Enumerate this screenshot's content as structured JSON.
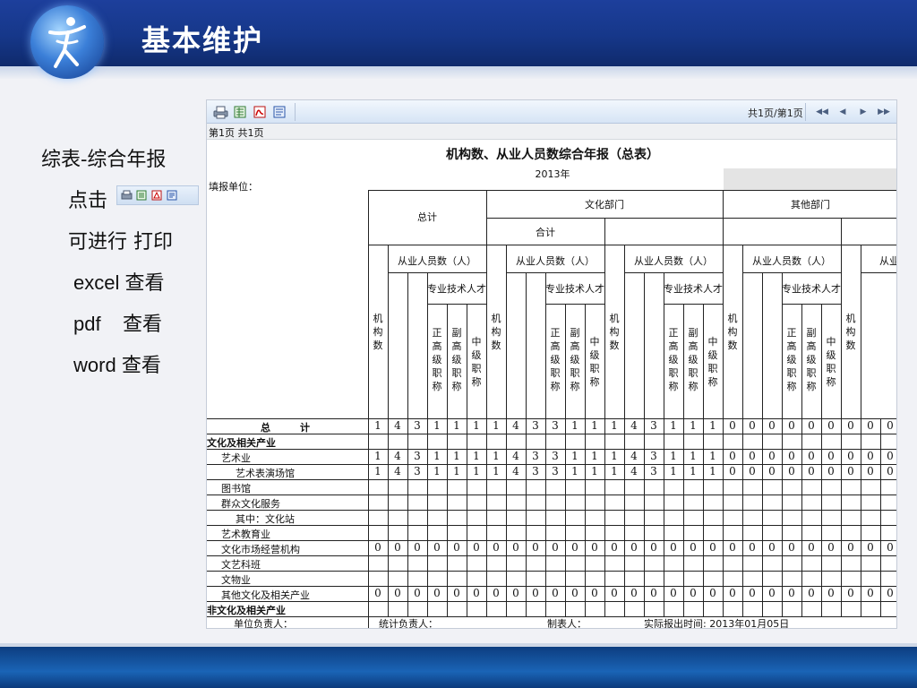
{
  "header": {
    "title": "基本维护"
  },
  "sidebar": {
    "line1": "综表-综合年报",
    "line2": "点击",
    "line3": "可进行 打印",
    "line4_a": "excel",
    "line4_b": "查看",
    "line5_a": "pdf",
    "line5_b": "查看",
    "line6_a": "word",
    "line6_b": "查看"
  },
  "viewer": {
    "toolbar": {
      "buttons": [
        "print-icon",
        "excel-icon",
        "pdf-icon",
        "word-icon"
      ],
      "page_counter": "共1页/第1页",
      "nav": [
        "first-page-icon",
        "prev-page-icon",
        "next-page-icon",
        "last-page-icon"
      ]
    },
    "page_info": "第1页  共1页",
    "report": {
      "title": "机构数、从业人员数综合年报（总表）",
      "year": "2013年",
      "fill_unit": "填报单位：",
      "headers": {
        "total": "总计",
        "culture_dept": "文化部门",
        "subtotal": "合计",
        "other_dept": "其他部门",
        "staff": "从业人员数（人）",
        "staff_cut": "从业",
        "tech": "专业技术人才",
        "orgs": "机构数",
        "senior": "正高级职称",
        "vice_senior": "副高级职称",
        "middle": "中级职称"
      },
      "rows": [
        {
          "label": "总　　　计",
          "values": [
            "1",
            "4",
            "3",
            "1",
            "1",
            "1",
            "1",
            "4",
            "3",
            "3",
            "1",
            "1",
            "1",
            "4",
            "3",
            "1",
            "1",
            "1",
            "0",
            "0",
            "0",
            "0",
            "0",
            "0",
            "0",
            "0",
            "0"
          ]
        },
        {
          "label": "文化及相关产业",
          "values": []
        },
        {
          "label": "艺术业",
          "values": [
            "1",
            "4",
            "3",
            "1",
            "1",
            "1",
            "1",
            "4",
            "3",
            "3",
            "1",
            "1",
            "1",
            "4",
            "3",
            "1",
            "1",
            "1",
            "0",
            "0",
            "0",
            "0",
            "0",
            "0",
            "0",
            "0",
            "0"
          ]
        },
        {
          "label": "艺术表演场馆",
          "values": [
            "1",
            "4",
            "3",
            "1",
            "1",
            "1",
            "1",
            "4",
            "3",
            "3",
            "1",
            "1",
            "1",
            "4",
            "3",
            "1",
            "1",
            "1",
            "0",
            "0",
            "0",
            "0",
            "0",
            "0",
            "0",
            "0",
            "0"
          ]
        },
        {
          "label": "图书馆",
          "values": []
        },
        {
          "label": "群众文化服务",
          "values": []
        },
        {
          "label": "其中：文化站",
          "values": []
        },
        {
          "label": "艺术教育业",
          "values": []
        },
        {
          "label": "文化市场经营机构",
          "values": [
            "0",
            "0",
            "0",
            "0",
            "0",
            "0",
            "0",
            "0",
            "0",
            "0",
            "0",
            "0",
            "0",
            "0",
            "0",
            "0",
            "0",
            "0",
            "0",
            "0",
            "0",
            "0",
            "0",
            "0",
            "0",
            "0",
            "0"
          ]
        },
        {
          "label": "文艺科班",
          "values": []
        },
        {
          "label": "文物业",
          "values": []
        },
        {
          "label": "其他文化及相关产业",
          "values": [
            "0",
            "0",
            "0",
            "0",
            "0",
            "0",
            "0",
            "0",
            "0",
            "0",
            "0",
            "0",
            "0",
            "0",
            "0",
            "0",
            "0",
            "0",
            "0",
            "0",
            "0",
            "0",
            "0",
            "0",
            "0",
            "0",
            "0"
          ]
        },
        {
          "label": "非文化及相关产业",
          "values": []
        }
      ],
      "signatures": {
        "unit_head": "单位负责人：",
        "stats_head": "统计负责人：",
        "preparer": "制表人：",
        "report_time": "实际报出时间: 2013年01月05日"
      }
    }
  },
  "colors": {
    "header": "#163789",
    "footer": "#1a64b6",
    "toolbar": "#d6e4f5"
  }
}
